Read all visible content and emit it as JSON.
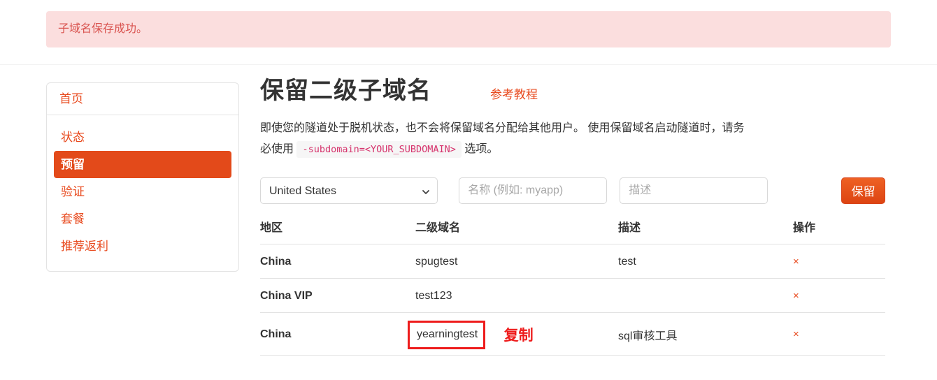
{
  "alert": {
    "message": "子域名保存成功。"
  },
  "sidebar": {
    "home": {
      "label": "首页"
    },
    "items": [
      {
        "label": "状态",
        "active": false
      },
      {
        "label": "预留",
        "active": true
      },
      {
        "label": "验证",
        "active": false
      },
      {
        "label": "套餐",
        "active": false
      },
      {
        "label": "推荐返利",
        "active": false
      }
    ]
  },
  "main": {
    "title": "保留二级子域名",
    "tutorial_link": "参考教程",
    "description_part1": "即使您的隧道处于脱机状态，也不会将保留域名分配给其他用户。 使用保留域名启动隧道时，请务必使用",
    "description_code": "-subdomain=<YOUR_SUBDOMAIN>",
    "description_part2": "选项。"
  },
  "form": {
    "region_selected": "United States",
    "region_options": [
      "United States"
    ],
    "name_placeholder": "名称 (例如: myapp)",
    "name_value": "",
    "desc_placeholder": "描述",
    "desc_value": "",
    "submit_label": "保留"
  },
  "table": {
    "headers": {
      "region": "地区",
      "subdomain": "二级域名",
      "description": "描述",
      "action": "操作"
    },
    "rows": [
      {
        "region": "China",
        "subdomain": "spugtest",
        "description": "test",
        "delete": "×"
      },
      {
        "region": "China VIP",
        "subdomain": "test123",
        "description": "",
        "delete": "×"
      },
      {
        "region": "China",
        "subdomain": "yearningtest",
        "description": "sql审核工具",
        "delete": "×"
      }
    ]
  },
  "annotations": {
    "copy_label": "复制"
  },
  "colors": {
    "accent_orange": "#e8491d",
    "active_bg": "#e34a1a",
    "alert_bg": "#fbdede",
    "alert_text": "#d9534f",
    "annotation_red": "#ee1c1c",
    "code_text": "#d6336c"
  }
}
